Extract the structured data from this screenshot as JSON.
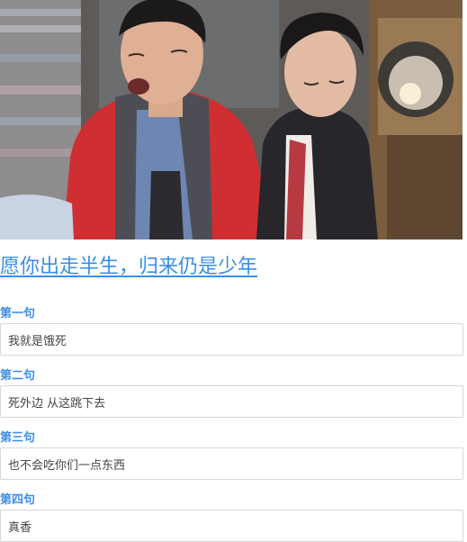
{
  "hero": {
    "image_subject": "two-young-men-photo"
  },
  "title": "愿你出走半生，归来仍是少年",
  "fields": [
    {
      "label": "第一句",
      "value": "我就是饿死"
    },
    {
      "label": "第二句",
      "value": "死外边 从这跳下去"
    },
    {
      "label": "第三句",
      "value": "也不会吃你们一点东西"
    },
    {
      "label": "第四句",
      "value": "真香"
    }
  ],
  "colors": {
    "accent": "#3a8ee8",
    "input_border": "#d7d7d7",
    "input_text": "#444444"
  }
}
